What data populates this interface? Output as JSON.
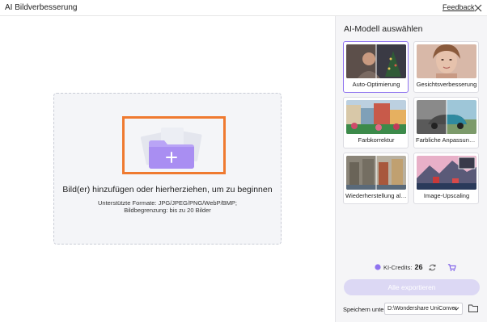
{
  "window": {
    "title": "AI Bildverbesserung",
    "feedback_label": "Feedback"
  },
  "dropzone": {
    "main_text": "Bild(er) hinzufügen oder hierherziehen, um zu beginnen",
    "formats_text": "Unterstützte Formate: JPG/JPEG/PNG/WebP/BMP;",
    "limit_text": "Bildbegrenzung: bis zu 20 Bilder"
  },
  "sidebar": {
    "title": "AI-Modell auswählen",
    "models": [
      {
        "label": "Auto-Optimierung",
        "selected": true,
        "icon": "auto-optimize-thumbnail"
      },
      {
        "label": "Gesichtsverbesserung",
        "selected": false,
        "icon": "face-enhance-thumbnail"
      },
      {
        "label": "Farbkorrektur",
        "selected": false,
        "icon": "color-correction-thumbnail"
      },
      {
        "label": "Farbliche Anpassung ...",
        "selected": false,
        "icon": "colorize-thumbnail"
      },
      {
        "label": "Wiederherstellung alt...",
        "selected": false,
        "icon": "old-photo-restore-thumbnail"
      },
      {
        "label": "Image-Upscaling",
        "selected": false,
        "icon": "upscaling-thumbnail"
      }
    ],
    "credits_label": "KI-Credits:",
    "credits_value": "26",
    "export_label": "Alle exportieren",
    "save_label": "Speichern unter:",
    "save_path": "D:\\Wondershare UniConver"
  },
  "colors": {
    "accent": "#8f73ef",
    "highlight_box": "#ef7a30",
    "export_disabled": "#dcd8f4"
  }
}
